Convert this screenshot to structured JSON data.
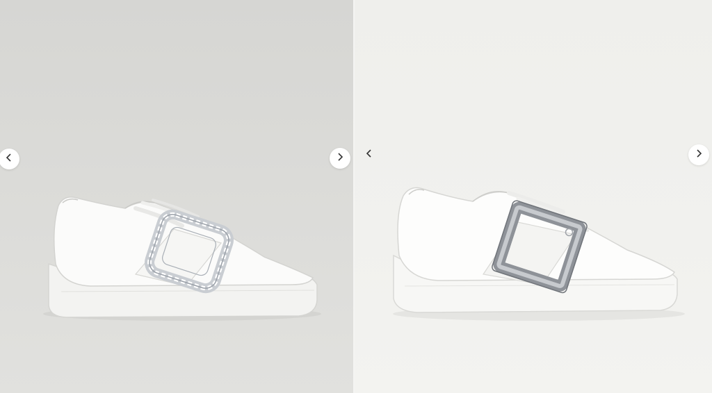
{
  "gallery": {
    "left_panel": {
      "product_image": "white-leather-sneaker-crystal-buckle",
      "prev_icon": "chevron-left-icon",
      "next_icon": "chevron-right-icon"
    },
    "right_panel": {
      "product_image": "white-leather-sneaker-silver-buckle",
      "prev_icon": "chevron-left-icon",
      "next_icon": "chevron-right-icon"
    }
  },
  "colors": {
    "left_background": "#d9d9d6",
    "right_background": "#f1f1ee",
    "button_fill": "#ffffff",
    "icon_stroke": "#333333"
  }
}
